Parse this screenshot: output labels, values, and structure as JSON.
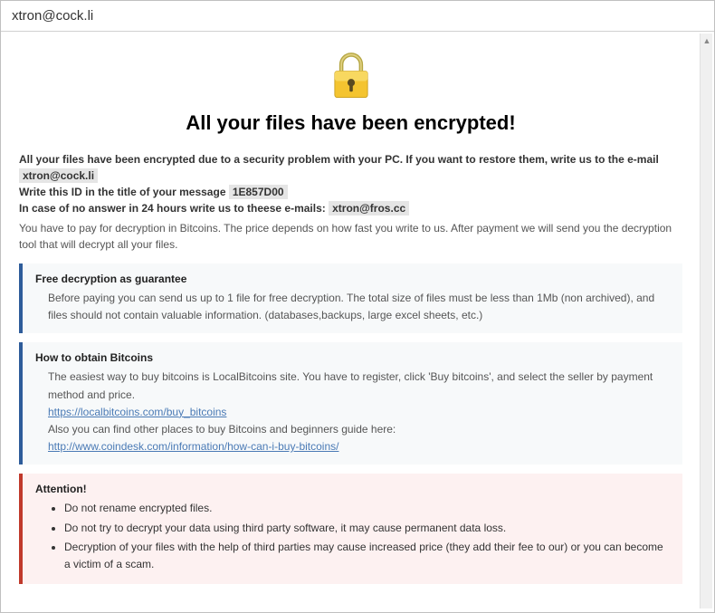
{
  "titlebar": "xtron@cock.li",
  "main_title": "All your files have been encrypted!",
  "intro": {
    "line1_prefix": "All your files have been encrypted due to a security problem with your PC. If you want to restore them, write us to the e-mail ",
    "email1": "xtron@cock.li",
    "line2_prefix": "Write this ID in the title of your message ",
    "id": "1E857D00",
    "line3_prefix": "In case of no answer in 24 hours write us to theese e-mails: ",
    "email2": "xtron@fros.cc"
  },
  "payment_note": "You have to pay for decryption in Bitcoins. The price depends on how fast you write to us. After payment we will send you the decryption tool that will decrypt all your files.",
  "guarantee": {
    "title": "Free decryption as guarantee",
    "body": "Before paying you can send us up to 1 file for free decryption. The total size of files must be less than 1Mb (non archived), and files should not contain valuable information. (databases,backups, large excel sheets, etc.)"
  },
  "bitcoins": {
    "title": "How to obtain Bitcoins",
    "line1": "The easiest way to buy bitcoins is LocalBitcoins site. You have to register, click 'Buy bitcoins', and select the seller by payment method and price.",
    "link1": "https://localbitcoins.com/buy_bitcoins",
    "line2": "Also you can find other places to buy Bitcoins and beginners guide here:",
    "link2": "http://www.coindesk.com/information/how-can-i-buy-bitcoins/"
  },
  "attention": {
    "title": "Attention!",
    "items": [
      "Do not rename encrypted files.",
      "Do not try to decrypt your data using third party software, it may cause permanent data loss.",
      "Decryption of your files with the help of third parties may cause increased price (they add their fee to our) or you can become a victim of a scam."
    ]
  }
}
